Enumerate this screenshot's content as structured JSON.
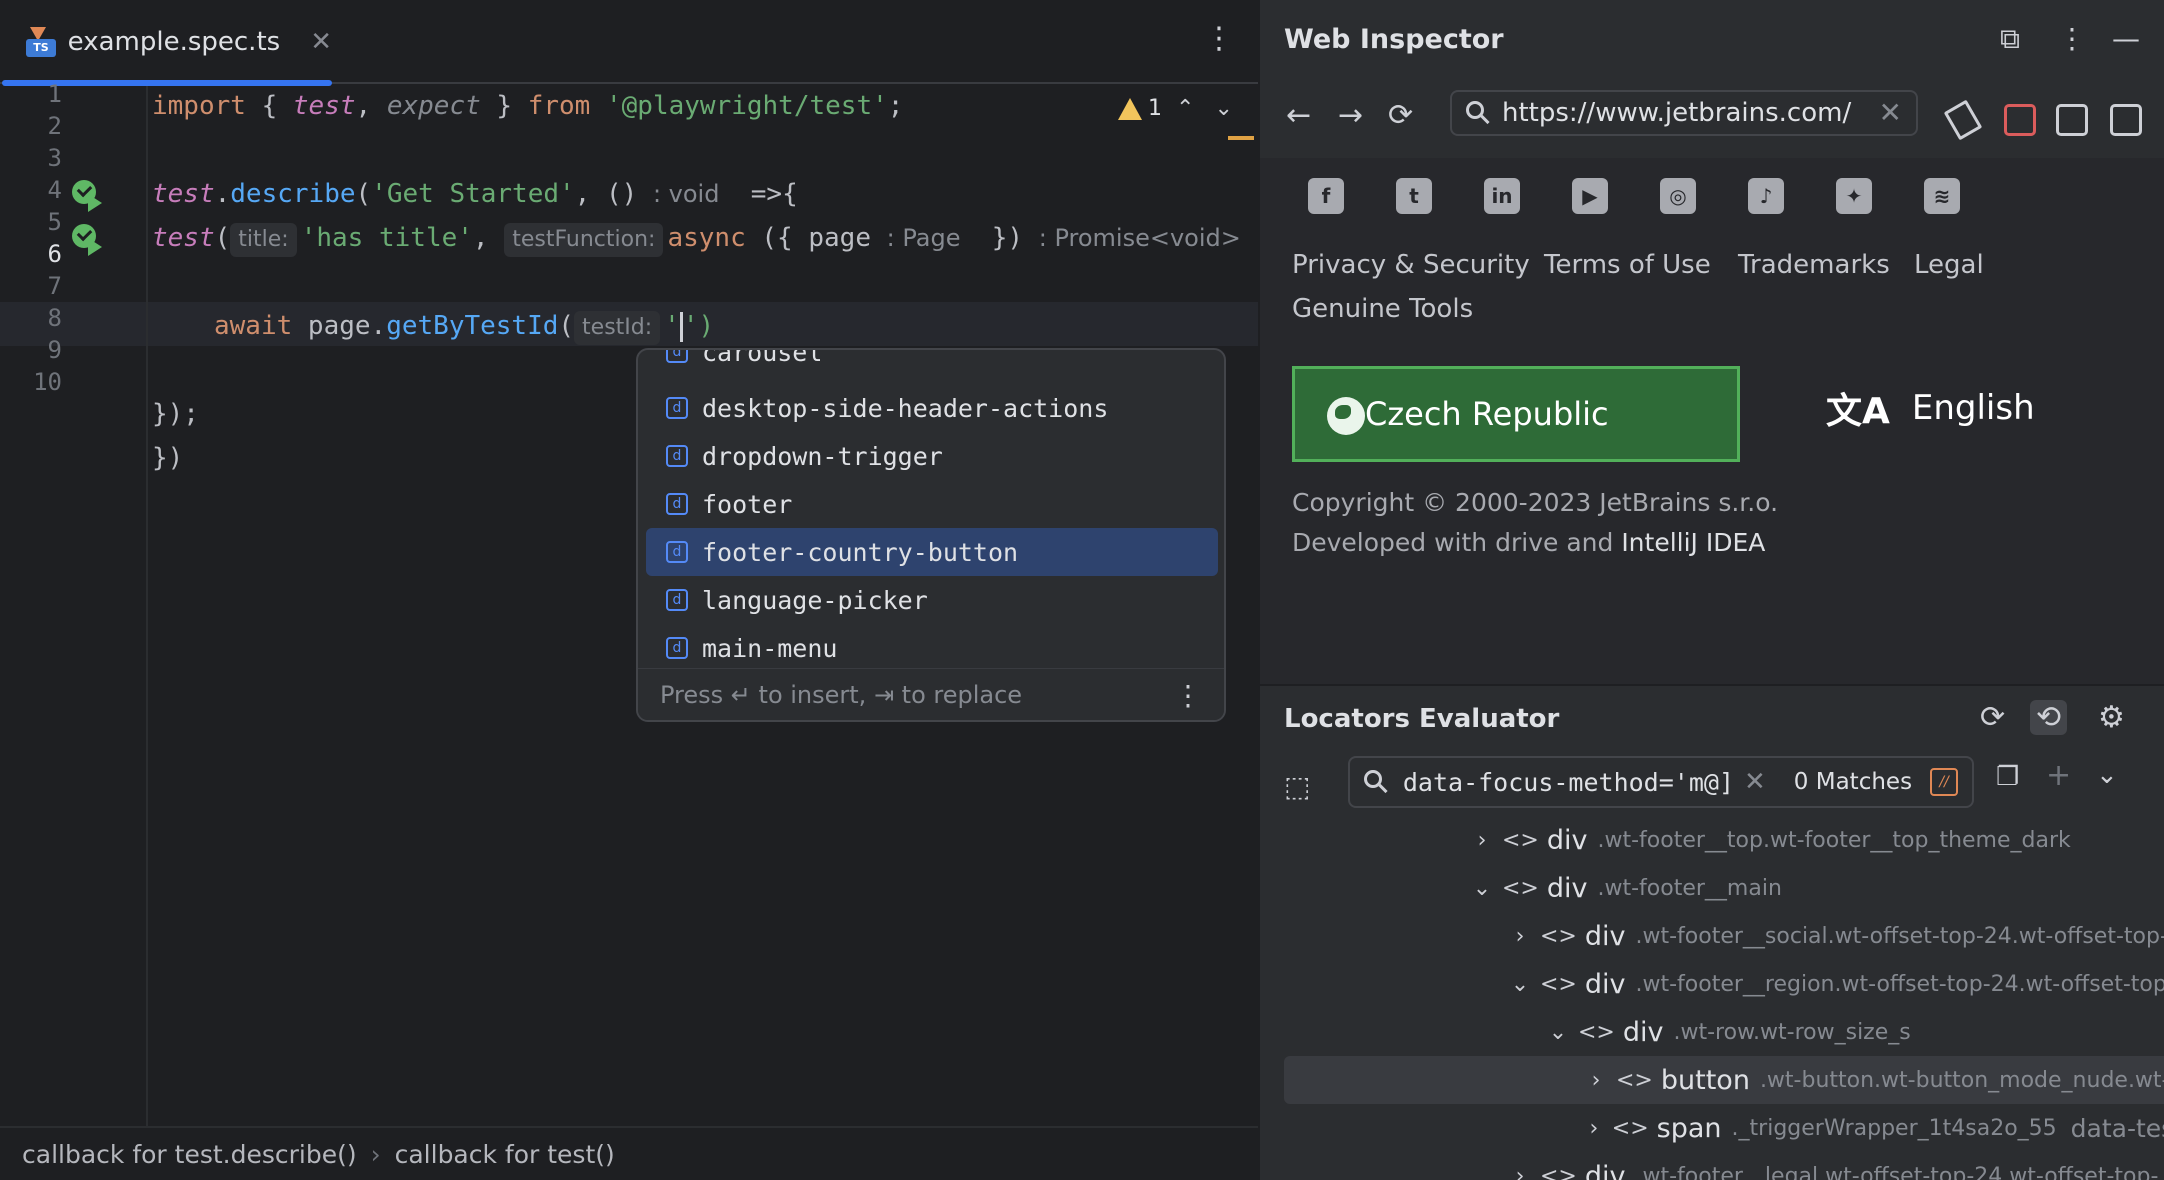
{
  "editor": {
    "tab": {
      "file_name": "example.spec.ts",
      "close": "✕"
    },
    "menu": "⋮",
    "line_numbers": [
      "1",
      "2",
      "3",
      "4",
      "5",
      "6",
      "7",
      "8",
      "9",
      "10"
    ],
    "line1": {
      "import": "import",
      "open": " { ",
      "test": "test",
      "comma": ", ",
      "expect": "expect",
      "close": " } ",
      "from": "from",
      "module": " '@playwright/test'",
      "semi": ";"
    },
    "line3": {
      "test": "test",
      "dot": ".",
      "describe": "describe",
      "open": "(",
      "str": "'Get Started'",
      "rest1": ", () ",
      "hint": ": void",
      "rest2": "  =>{"
    },
    "line4": {
      "test": "test",
      "open": "(",
      "hint_title": "title:",
      "str": "'has title'",
      "comma": ", ",
      "hint_fn": "testFunction:",
      "async": "async",
      "params": " ({ page ",
      "type": ": Page",
      "close": "  }) ",
      "ret": ": Promise<void>"
    },
    "line6": {
      "await": "await",
      "page": " page.",
      "method": "getByTestId",
      "open": "(",
      "hint": "testId:",
      "quote_open": "'",
      "close": "')"
    },
    "line8": "});",
    "line9": "})",
    "warning_count": "1",
    "nav_up": "⌃",
    "nav_down": "⌄",
    "breadcrumb": [
      "callback for test.describe()",
      "callback for test()"
    ],
    "breadcrumb_sep": "›"
  },
  "completion": {
    "partial_item": "carousel",
    "items": [
      "desktop-side-header-actions",
      "dropdown-trigger",
      "footer",
      "footer-country-button",
      "language-picker",
      "main-menu"
    ],
    "selected": "footer-country-button",
    "kind_badge": "d",
    "footer_hint": "Press ↵ to insert, ⇥ to replace",
    "menu": "⋮"
  },
  "web_inspector": {
    "title": "Web Inspector",
    "icons": {
      "open_external": "⧉",
      "menu": "⋮",
      "minimize": "—"
    },
    "nav": {
      "back": "←",
      "forward": "→",
      "reload": "⟳"
    },
    "url": "https://www.jetbrains.com/",
    "url_clear": "✕",
    "social": [
      "f",
      "t",
      "in",
      "▶",
      "◎",
      "♪",
      "✦",
      "≋"
    ],
    "footer_links": [
      "Privacy & Security",
      "Terms of Use",
      "Trademarks",
      "Legal",
      "Genuine Tools"
    ],
    "country_button": "Czech Republic",
    "language": "English",
    "language_icon": "文A",
    "copyright": "Copyright © 2000-2023 JetBrains s.r.o.",
    "developed_prefix": "Developed with drive and",
    "developed_link": "IntelliJ IDEA"
  },
  "locators": {
    "title": "Locators Evaluator",
    "icons": {
      "refresh": "⟳",
      "history": "⟲",
      "settings": "⚙",
      "pick": "⬚",
      "copy": "❐",
      "add": "+",
      "expand": "⌄"
    },
    "search_value": "[@data-focus-method='m",
    "search_clear": "✕",
    "matches": "0 Matches",
    "regex": "//",
    "tree": [
      {
        "chevron": "›",
        "tag": "div",
        "cls": ".wt-footer__top.wt-footer__top_theme_dark",
        "attr": ""
      },
      {
        "chevron": "⌄",
        "tag": "div",
        "cls": ".wt-footer__main",
        "attr": ""
      },
      {
        "chevron": "›",
        "tag": "div",
        "cls": ".wt-footer__social.wt-offset-top-24.wt-offset-top-",
        "attr": ""
      },
      {
        "chevron": "⌄",
        "tag": "div",
        "cls": ".wt-footer__region.wt-offset-top-24.wt-offset-top",
        "attr": ""
      },
      {
        "chevron": "⌄",
        "tag": "div",
        "cls": ".wt-row.wt-row_size_s",
        "attr": ""
      },
      {
        "chevron": "›",
        "tag": "button",
        "cls": ".wt-button.wt-button_mode_nude.wt-b",
        "attr": ""
      },
      {
        "chevron": "›",
        "tag": "span",
        "cls": "._triggerWrapper_1t4sa2o_55",
        "attr": "data-test"
      },
      {
        "chevron": "›",
        "tag": "div",
        "cls": ".wt-footer__legal.wt-offset-top-24.wt-offset-top-",
        "attr": ""
      }
    ],
    "tag_icon": "<>"
  },
  "colors": {
    "accent": "#3574f0",
    "country_button": "#2e6b37",
    "selection": "#2e436e",
    "warning": "#f2c55c"
  }
}
